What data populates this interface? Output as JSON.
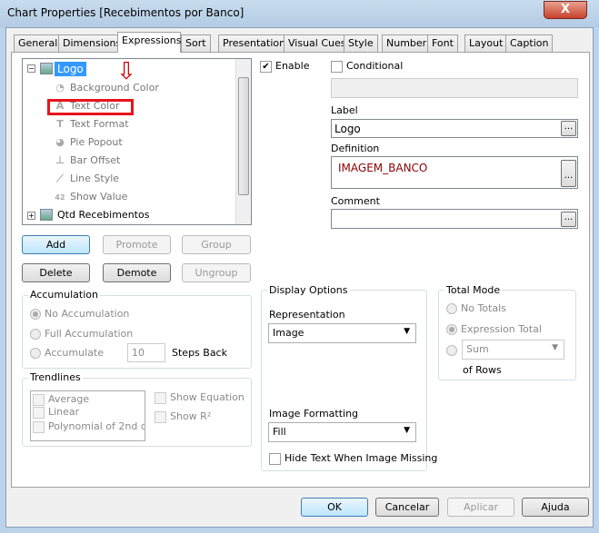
{
  "window": {
    "title": "Chart Properties [Recebimentos por Banco]",
    "close": "X"
  },
  "tabs": [
    "General",
    "Dimensions",
    "Expressions",
    "Sort",
    "Presentation",
    "Visual Cues",
    "Style",
    "Number",
    "Font",
    "Layout",
    "Caption"
  ],
  "tree": {
    "root1": "Logo",
    "children": [
      "Background Color",
      "Text Color",
      "Text Format",
      "Pie Popout",
      "Bar Offset",
      "Line Style",
      "Show Value"
    ],
    "root2": "Qtd Recebimentos",
    "expand_minus": "−",
    "expand_plus": "+"
  },
  "buttons": {
    "add": "Add",
    "promote": "Promote",
    "group": "Group",
    "delete": "Delete",
    "demote": "Demote",
    "ungroup": "Ungroup"
  },
  "accumulation": {
    "title": "Accumulation",
    "no": "No Accumulation",
    "full": "Full Accumulation",
    "accumulate": "Accumulate",
    "steps_value": "10",
    "steps_label": "Steps Back"
  },
  "trendlines": {
    "title": "Trendlines",
    "items": [
      "Average",
      "Linear",
      "Polynomial of 2nd d"
    ],
    "show_equation": "Show Equation",
    "show_r2": "Show R²"
  },
  "right": {
    "enable": "Enable",
    "conditional": "Conditional",
    "label_title": "Label",
    "label_value": "Logo",
    "definition_title": "Definition",
    "definition_value": "IMAGEM_BANCO",
    "comment_title": "Comment",
    "comment_value": "",
    "ellipsis": "..."
  },
  "display": {
    "title": "Display Options",
    "representation_label": "Representation",
    "representation_value": "Image",
    "image_formatting_label": "Image Formatting",
    "image_formatting_value": "Fill",
    "hide_text": "Hide Text When Image Missing"
  },
  "total": {
    "title": "Total Mode",
    "no_totals": "No Totals",
    "expression_total": "Expression Total",
    "sum": "Sum",
    "of_rows": "of Rows"
  },
  "footer": {
    "ok": "OK",
    "cancel": "Cancelar",
    "apply": "Aplicar",
    "help": "Ajuda"
  },
  "annotation_arrow": "⇩"
}
